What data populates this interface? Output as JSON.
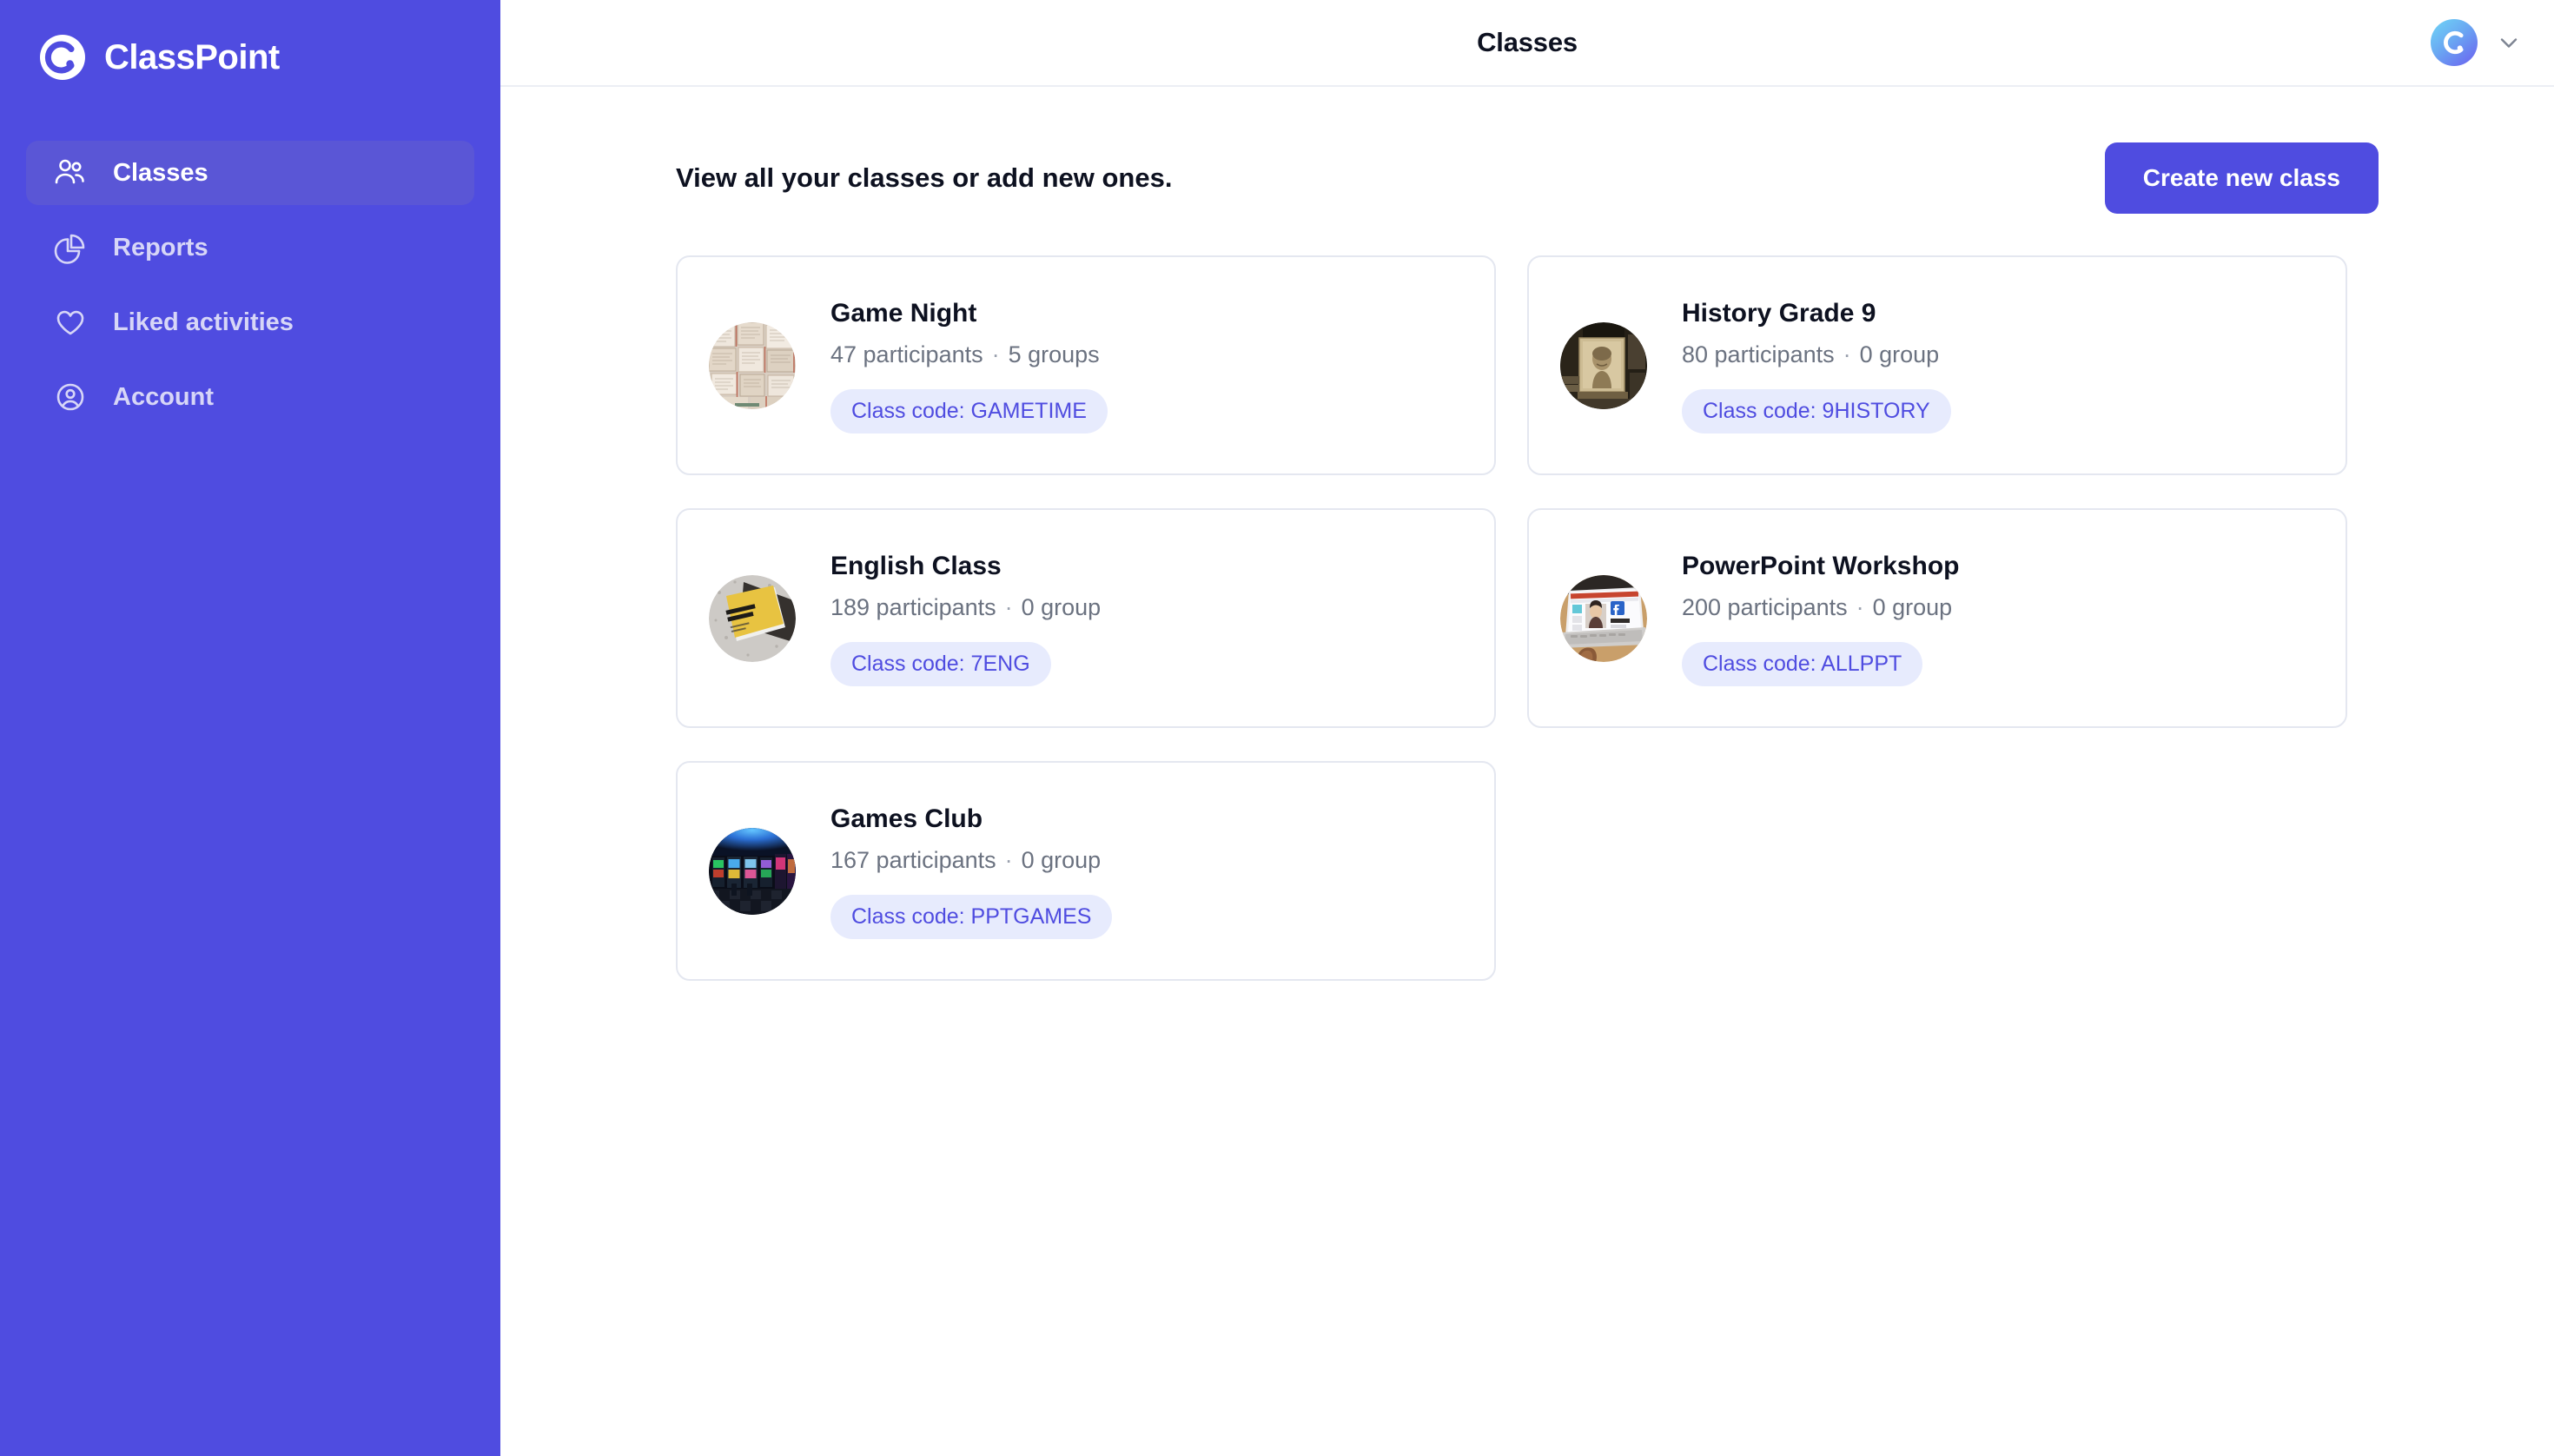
{
  "brand": {
    "name": "ClassPoint",
    "logo_icon": "classpoint-logo-icon"
  },
  "sidebar": {
    "items": [
      {
        "label": "Classes",
        "icon": "users-group-icon",
        "active": true
      },
      {
        "label": "Reports",
        "icon": "pie-chart-icon",
        "active": false
      },
      {
        "label": "Liked activities",
        "icon": "heart-icon",
        "active": false
      },
      {
        "label": "Account",
        "icon": "user-circle-icon",
        "active": false
      }
    ]
  },
  "topbar": {
    "title": "Classes",
    "avatar_icon": "classpoint-avatar-icon",
    "chevron_icon": "chevron-down-icon"
  },
  "content": {
    "heading": "View all your classes or add new ones.",
    "create_button": "Create new class"
  },
  "classes": [
    {
      "title": "Game Night",
      "participants": "47 participants",
      "separator": "·",
      "groups": "5 groups",
      "class_code": "Class code: GAMETIME",
      "thumbnail": "stacked-open-books-photo"
    },
    {
      "title": "History Grade 9",
      "participants": "80 participants",
      "separator": "·",
      "groups": "0 group",
      "class_code": "Class code: 9HISTORY",
      "thumbnail": "vintage-portrait-photo"
    },
    {
      "title": "English Class",
      "participants": "189 participants",
      "separator": "·",
      "groups": "0 group",
      "class_code": "Class code: 7ENG",
      "thumbnail": "everyday-english-book-photo"
    },
    {
      "title": "PowerPoint Workshop",
      "participants": "200 participants",
      "separator": "·",
      "groups": "0 group",
      "class_code": "Class code: ALLPPT",
      "thumbnail": "laptop-presentation-photo"
    },
    {
      "title": "Games Club",
      "participants": "167 participants",
      "separator": "·",
      "groups": "0 group",
      "class_code": "Class code: PPTGAMES",
      "thumbnail": "arcade-room-photo"
    }
  ],
  "colors": {
    "sidebar_bg": "#4f4ce0",
    "sidebar_active": "#5a56d6",
    "accent": "#4f4ce0",
    "badge_bg": "#e7ebfd",
    "badge_text": "#4f4ce0",
    "card_border": "#e4e7f0",
    "muted_text": "#6b7280",
    "title_text": "#0d1120"
  }
}
